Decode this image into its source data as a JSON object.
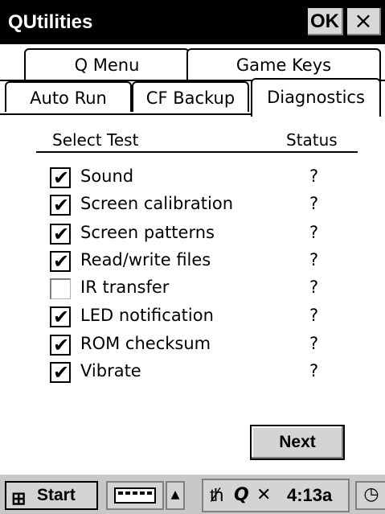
{
  "window": {
    "title": "QUtilities",
    "ok_label": "OK",
    "close_label": "×"
  },
  "tabs": {
    "row1": [
      "Q Menu",
      "Game Keys"
    ],
    "row2": [
      "Auto Run",
      "CF Backup",
      "Diagnostics"
    ],
    "active": "Diagnostics"
  },
  "panel": {
    "col_test": "Select Test",
    "col_status": "Status",
    "tests": [
      {
        "label": "Sound",
        "checked": true,
        "status": "?"
      },
      {
        "label": "Screen calibration",
        "checked": true,
        "status": "?"
      },
      {
        "label": "Screen patterns",
        "checked": true,
        "status": "?"
      },
      {
        "label": "Read/write files",
        "checked": true,
        "status": "?"
      },
      {
        "label": "IR transfer",
        "checked": false,
        "status": "?"
      },
      {
        "label": "LED notification",
        "checked": true,
        "status": "?"
      },
      {
        "label": "ROM checksum",
        "checked": true,
        "status": "?"
      },
      {
        "label": "Vibrate",
        "checked": true,
        "status": "?"
      }
    ],
    "next_label": "Next"
  },
  "taskbar": {
    "start_label": "Start",
    "time": "4:13a",
    "icons": [
      "windows-flag-icon",
      "keyboard-icon",
      "up-arrow-icon",
      "connectivity-icon",
      "q-icon",
      "volume-muted-icon",
      "clock-icon"
    ]
  }
}
